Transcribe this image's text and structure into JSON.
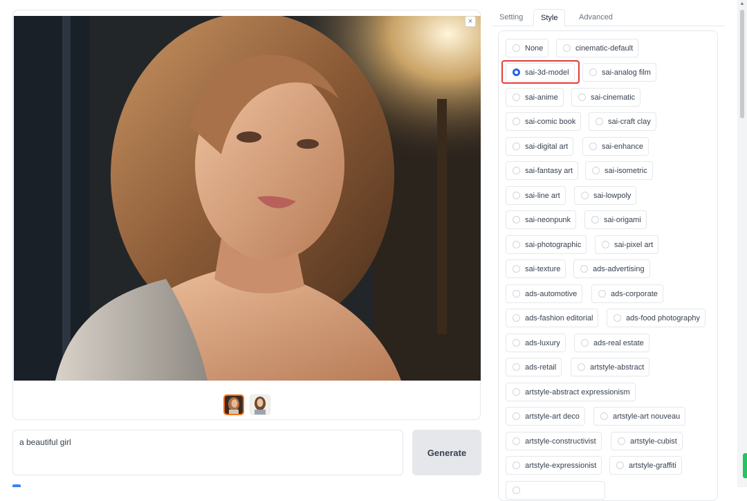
{
  "gallery": {
    "close_label": "×",
    "thumbnails": [
      "portrait-1",
      "portrait-2"
    ]
  },
  "prompt": {
    "value": "a beautiful girl"
  },
  "generate_label": "Generate",
  "tabs": [
    {
      "label": "Setting",
      "active": false
    },
    {
      "label": "Style",
      "active": true
    },
    {
      "label": "Advanced",
      "active": false
    }
  ],
  "styles": [
    {
      "label": "None",
      "checked": false
    },
    {
      "label": "cinematic-default",
      "checked": false
    },
    {
      "label": "sai-3d-model",
      "checked": true
    },
    {
      "label": "sai-analog film",
      "checked": false
    },
    {
      "label": "sai-anime",
      "checked": false
    },
    {
      "label": "sai-cinematic",
      "checked": false
    },
    {
      "label": "sai-comic book",
      "checked": false
    },
    {
      "label": "sai-craft clay",
      "checked": false
    },
    {
      "label": "sai-digital art",
      "checked": false
    },
    {
      "label": "sai-enhance",
      "checked": false
    },
    {
      "label": "sai-fantasy art",
      "checked": false
    },
    {
      "label": "sai-isometric",
      "checked": false
    },
    {
      "label": "sai-line art",
      "checked": false
    },
    {
      "label": "sai-lowpoly",
      "checked": false
    },
    {
      "label": "sai-neonpunk",
      "checked": false
    },
    {
      "label": "sai-origami",
      "checked": false
    },
    {
      "label": "sai-photographic",
      "checked": false
    },
    {
      "label": "sai-pixel art",
      "checked": false
    },
    {
      "label": "sai-texture",
      "checked": false
    },
    {
      "label": "ads-advertising",
      "checked": false
    },
    {
      "label": "ads-automotive",
      "checked": false
    },
    {
      "label": "ads-corporate",
      "checked": false
    },
    {
      "label": "ads-fashion editorial",
      "checked": false
    },
    {
      "label": "ads-food photography",
      "checked": false
    },
    {
      "label": "ads-luxury",
      "checked": false
    },
    {
      "label": "ads-real estate",
      "checked": false
    },
    {
      "label": "ads-retail",
      "checked": false
    },
    {
      "label": "artstyle-abstract",
      "checked": false
    },
    {
      "label": "artstyle-abstract expressionism",
      "checked": false
    },
    {
      "label": "artstyle-art deco",
      "checked": false
    },
    {
      "label": "artstyle-art nouveau",
      "checked": false
    },
    {
      "label": "artstyle-constructivist",
      "checked": false
    },
    {
      "label": "artstyle-cubist",
      "checked": false
    },
    {
      "label": "artstyle-expressionist",
      "checked": false
    },
    {
      "label": "artstyle-graffiti",
      "checked": false
    }
  ],
  "colors": {
    "accent": "#2563eb",
    "highlight": "#e23b3b",
    "thumb_selected": "#f97316"
  }
}
